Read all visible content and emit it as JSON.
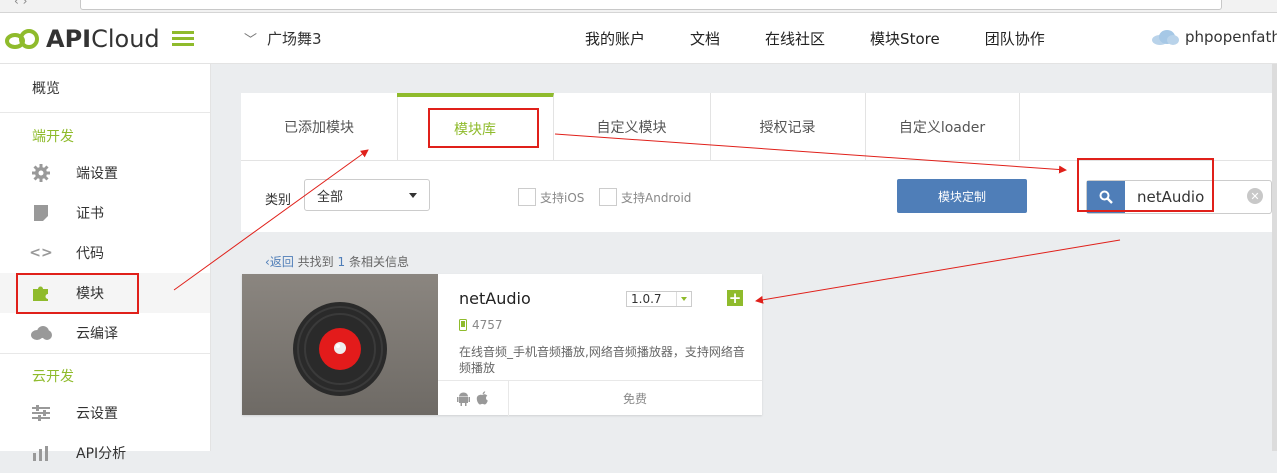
{
  "header": {
    "logo_text": "APICloud",
    "project_name": "广场舞3",
    "nav": [
      "我的账户",
      "文档",
      "在线社区",
      "模块Store",
      "团队协作"
    ],
    "username": "phpopenfathe"
  },
  "sidebar": {
    "overview": "概览",
    "section_client": "端开发",
    "client_items": [
      {
        "label": "端设置",
        "icon": "gear-icon"
      },
      {
        "label": "证书",
        "icon": "certificate-icon"
      },
      {
        "label": "代码",
        "icon": "code-icon"
      },
      {
        "label": "模块",
        "icon": "puzzle-icon"
      },
      {
        "label": "云编译",
        "icon": "cloud-icon"
      }
    ],
    "section_cloud": "云开发",
    "cloud_items": [
      {
        "label": "云设置",
        "icon": "sliders-icon"
      },
      {
        "label": "API分析",
        "icon": "chart-icon"
      }
    ]
  },
  "tabs": [
    "已添加模块",
    "模块库",
    "自定义模块",
    "授权记录",
    "自定义loader"
  ],
  "filter": {
    "category_label": "类别",
    "category_value": "全部",
    "support_ios": "支持iOS",
    "support_android": "支持Android",
    "custom_button": "模块定制",
    "search_value": "netAudio"
  },
  "results": {
    "back": "返回",
    "prefix": "共找到",
    "count": "1",
    "suffix": "条相关信息"
  },
  "module": {
    "name": "netAudio",
    "version": "1.0.7",
    "downloads": "4757",
    "description": "在线音频_手机音频播放,网络音频播放器，支持网络音频播放",
    "price": "免费"
  },
  "colors": {
    "accent_green": "#8fbb2c",
    "button_blue": "#4f7eb8",
    "annotation_red": "#e0201a"
  }
}
